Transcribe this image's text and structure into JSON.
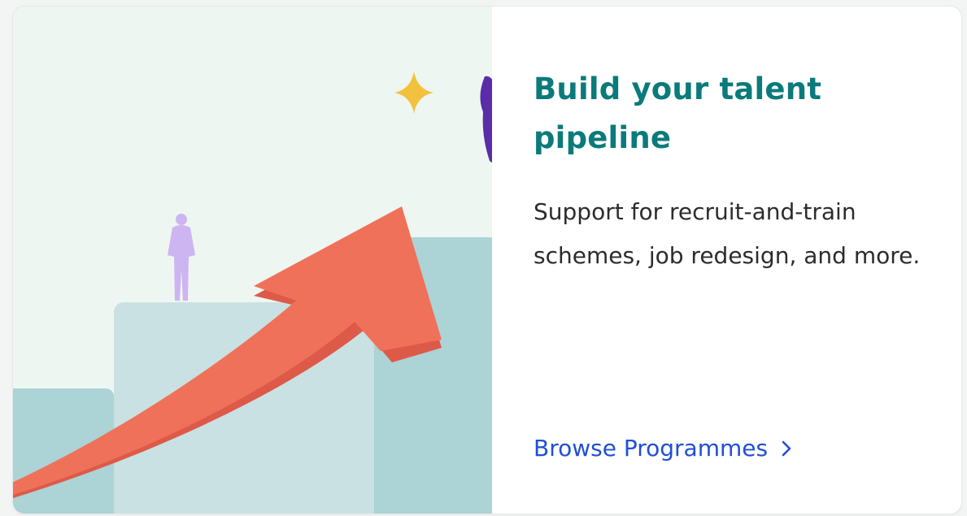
{
  "card": {
    "title": "Build your talent pipeline",
    "description": "Support for recruit-and-train schemes, job redesign, and more.",
    "cta_label": "Browse Programmes",
    "cta_icon": "chevron-right-icon"
  },
  "illustration": {
    "icons": [
      "sparkle-icon",
      "person-figure-icon",
      "upward-arrow-icon"
    ],
    "colors": {
      "background": "#eef6f1",
      "arrow": "#f07159",
      "arrow_shadow": "#de5a48",
      "step_light": "#c9e1e2",
      "step_dark": "#acd3d6",
      "sparkle": "#f2c13d",
      "person_light": "#cdb5f2",
      "person_dark": "#5b2ca8"
    }
  },
  "theme": {
    "title_color": "#0b7a7a",
    "link_color": "#1f4fd6",
    "text_color": "#2c2c2c"
  }
}
